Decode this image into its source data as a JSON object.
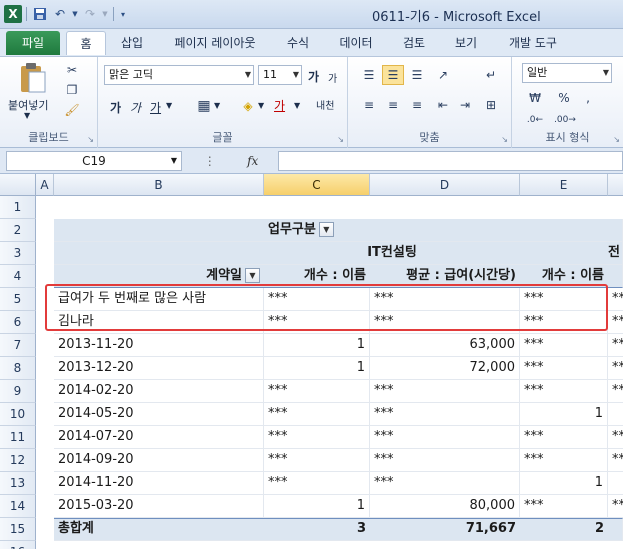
{
  "window": {
    "app_icon": "X",
    "title": "0611-기6  -  Microsoft Excel"
  },
  "ribbon": {
    "file_tab": "파일",
    "tabs": [
      "홈",
      "삽입",
      "페이지 레이아웃",
      "수식",
      "데이터",
      "검토",
      "보기",
      "개발 도구"
    ],
    "active_tab": "홈",
    "groups": {
      "clipboard": {
        "label": "클립보드",
        "paste": "붙여넣기"
      },
      "font": {
        "label": "글꼴",
        "font_name": "맑은 고딕",
        "font_size": "11",
        "bold": "가",
        "italic": "가",
        "underline": "가",
        "grow": "가",
        "shrink": "가",
        "color_a": "가",
        "phonetic": "내천"
      },
      "alignment": {
        "label": "맞춤"
      },
      "number": {
        "label": "표시 형식",
        "format": "일반"
      }
    }
  },
  "formula_bar": {
    "name_box": "C19",
    "fx": "fx",
    "value": ""
  },
  "columns": [
    "A",
    "B",
    "C",
    "D",
    "E"
  ],
  "active_column": "C",
  "rows": [
    "1",
    "2",
    "3",
    "4",
    "5",
    "6",
    "7",
    "8",
    "9",
    "10",
    "11",
    "12",
    "13",
    "14",
    "15",
    "16"
  ],
  "pivot": {
    "col_field_label": "업무구분",
    "group_header": "IT컨설팅",
    "group_header_partial": "전",
    "row_field_label": "계약일",
    "col_count": "개수 : 이름",
    "col_avg": "평균 : 급여(시간당)",
    "col_count2": "개수 : 이름",
    "rows": [
      {
        "label": "급여가 두 번째로 많은 사람",
        "c": "***",
        "d": "***",
        "e": "***",
        "f": "**"
      },
      {
        "label": "김나라",
        "c": "***",
        "d": "***",
        "e": "***",
        "f": "**"
      },
      {
        "label": "2013-11-20",
        "c": "1",
        "d": "63,000",
        "e": "***",
        "f": "**"
      },
      {
        "label": "2013-12-20",
        "c": "1",
        "d": "72,000",
        "e": "***",
        "f": "**"
      },
      {
        "label": "2014-02-20",
        "c": "***",
        "d": "***",
        "e": "***",
        "f": "**"
      },
      {
        "label": "2014-05-20",
        "c": "***",
        "d": "***",
        "e": "1",
        "f": ""
      },
      {
        "label": "2014-07-20",
        "c": "***",
        "d": "***",
        "e": "***",
        "f": "**"
      },
      {
        "label": "2014-09-20",
        "c": "***",
        "d": "***",
        "e": "***",
        "f": "**"
      },
      {
        "label": "2014-11-20",
        "c": "***",
        "d": "***",
        "e": "1",
        "f": ""
      },
      {
        "label": "2015-03-20",
        "c": "1",
        "d": "80,000",
        "e": "***",
        "f": "**"
      }
    ],
    "total": {
      "label": "총합계",
      "c": "3",
      "d": "71,667",
      "e": "2",
      "f": ""
    }
  }
}
